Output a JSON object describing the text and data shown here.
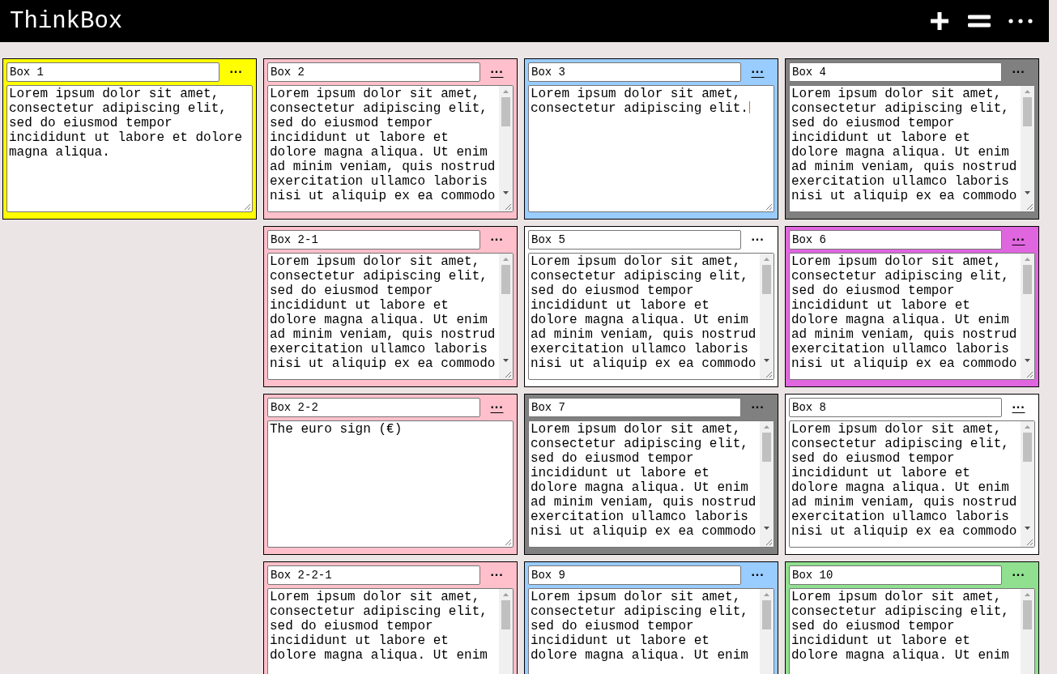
{
  "app": {
    "title": "ThinkBox"
  },
  "boxes": [
    {
      "title": "Box 1",
      "color": "#ffff00",
      "menu": "···",
      "underlined": false,
      "scrollable": false,
      "focused": false,
      "text": "Lorem ipsum dolor sit amet, consectetur adipiscing elit, sed do eiusmod tempor incididunt ut labore et dolore magna aliqua."
    },
    {
      "title": "Box 2",
      "color": "#ffc0cb",
      "menu": "···",
      "underlined": true,
      "scrollable": true,
      "focused": false,
      "text": "Lorem ipsum dolor sit amet, consectetur adipiscing elit, sed do eiusmod tempor incididunt ut labore et dolore magna aliqua. Ut enim ad minim veniam, quis nostrud exercitation ullamco laboris nisi ut aliquip ex ea commodo"
    },
    {
      "title": "Box 3",
      "color": "#99ccff",
      "menu": "···",
      "underlined": true,
      "scrollable": false,
      "focused": true,
      "text": "Lorem ipsum dolor sit amet, consectetur adipiscing elit."
    },
    {
      "title": "Box 4",
      "color": "#808080",
      "menu": "···",
      "underlined": false,
      "scrollable": true,
      "focused": false,
      "text": "Lorem ipsum dolor sit amet, consectetur adipiscing elit, sed do eiusmod tempor incididunt ut labore et dolore magna aliqua. Ut enim ad minim veniam, quis nostrud exercitation ullamco laboris nisi ut aliquip ex ea commodo"
    },
    {
      "title": "Box 2-1",
      "color": "#ffc0cb",
      "menu": "···",
      "underlined": false,
      "scrollable": true,
      "focused": false,
      "text": "Lorem ipsum dolor sit amet, consectetur adipiscing elit, sed do eiusmod tempor incididunt ut labore et dolore magna aliqua. Ut enim ad minim veniam, quis nostrud exercitation ullamco laboris nisi ut aliquip ex ea commodo"
    },
    {
      "title": "Box 5",
      "color": "#ffffff",
      "menu": "···",
      "underlined": false,
      "scrollable": true,
      "focused": false,
      "text": "Lorem ipsum dolor sit amet, consectetur adipiscing elit, sed do eiusmod tempor incididunt ut labore et dolore magna aliqua. Ut enim ad minim veniam, quis nostrud exercitation ullamco laboris nisi ut aliquip ex ea commodo"
    },
    {
      "title": "Box 6",
      "color": "#e066e0",
      "menu": "···",
      "underlined": true,
      "scrollable": true,
      "focused": false,
      "text": "Lorem ipsum dolor sit amet, consectetur adipiscing elit, sed do eiusmod tempor incididunt ut labore et dolore magna aliqua. Ut enim ad minim veniam, quis nostrud exercitation ullamco laboris nisi ut aliquip ex ea commodo"
    },
    {
      "title": "Box 2-2",
      "color": "#ffc0cb",
      "menu": "···",
      "underlined": true,
      "scrollable": false,
      "focused": false,
      "text": "The euro sign (€)"
    },
    {
      "title": "Box 7",
      "color": "#808080",
      "menu": "···",
      "underlined": false,
      "scrollable": true,
      "focused": false,
      "text": "Lorem ipsum dolor sit amet, consectetur adipiscing elit, sed do eiusmod tempor incididunt ut labore et dolore magna aliqua. Ut enim ad minim veniam, quis nostrud exercitation ullamco laboris nisi ut aliquip ex ea commodo"
    },
    {
      "title": "Box 8",
      "color": "#ffffff",
      "menu": "···",
      "underlined": true,
      "scrollable": true,
      "focused": false,
      "text": "Lorem ipsum dolor sit amet, consectetur adipiscing elit, sed do eiusmod tempor incididunt ut labore et dolore magna aliqua. Ut enim ad minim veniam, quis nostrud exercitation ullamco laboris nisi ut aliquip ex ea commodo"
    },
    {
      "title": "Box 2-2-1",
      "color": "#ffc0cb",
      "menu": "···",
      "underlined": false,
      "scrollable": true,
      "focused": false,
      "text": "Lorem ipsum dolor sit amet, consectetur adipiscing elit, sed do eiusmod tempor incididunt ut labore et dolore magna aliqua. Ut enim"
    },
    {
      "title": "Box 9",
      "color": "#99ccff",
      "menu": "···",
      "underlined": false,
      "scrollable": true,
      "focused": false,
      "text": "Lorem ipsum dolor sit amet, consectetur adipiscing elit, sed do eiusmod tempor incididunt ut labore et dolore magna aliqua. Ut enim"
    },
    {
      "title": "Box 10",
      "color": "#90e090",
      "menu": "···",
      "underlined": false,
      "scrollable": true,
      "focused": false,
      "text": "Lorem ipsum dolor sit amet, consectetur adipiscing elit, sed do eiusmod tempor incididunt ut labore et dolore magna aliqua. Ut enim"
    }
  ]
}
